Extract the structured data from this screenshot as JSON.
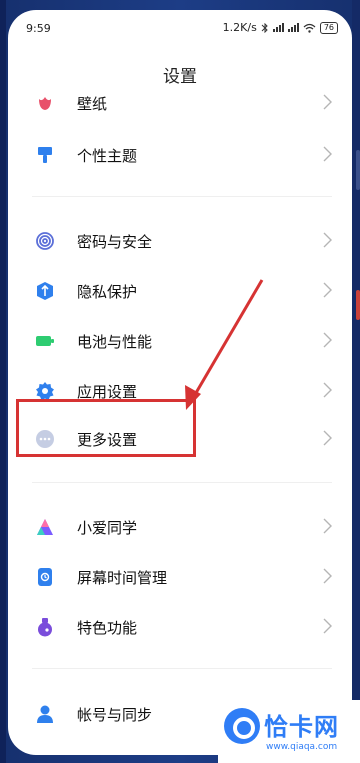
{
  "status_bar": {
    "time": "9:59",
    "net_speed": "1.2K/s",
    "battery": "76"
  },
  "header": {
    "title": "设置"
  },
  "groups": [
    {
      "items": [
        {
          "label": "壁纸",
          "icon": "flower-icon",
          "color": "#e8506a"
        },
        {
          "label": "个性主题",
          "icon": "paint-brush-icon",
          "color": "#2f80ed"
        }
      ]
    },
    {
      "items": [
        {
          "label": "密码与安全",
          "icon": "fingerprint-icon",
          "color": "#5b6fd8"
        },
        {
          "label": "隐私保护",
          "icon": "privacy-shield-icon",
          "color": "#2f80ed"
        },
        {
          "label": "电池与性能",
          "icon": "battery-icon",
          "color": "#2ecc71"
        },
        {
          "label": "应用设置",
          "icon": "gear-icon",
          "color": "#2f80ed"
        },
        {
          "label": "更多设置",
          "icon": "more-dots-icon",
          "color": "#9aa6c7"
        }
      ]
    },
    {
      "items": [
        {
          "label": "小爱同学",
          "icon": "xiaoai-icon",
          "color": "#7a5cff"
        },
        {
          "label": "屏幕时间管理",
          "icon": "screen-time-icon",
          "color": "#2f80ed"
        },
        {
          "label": "特色功能",
          "icon": "flask-icon",
          "color": "#7a4ddb"
        }
      ]
    },
    {
      "items": [
        {
          "label": "帐号与同步",
          "icon": "account-icon",
          "color": "#2f80ed"
        }
      ]
    }
  ],
  "watermark": {
    "brand": "恰卡网",
    "url": "www.qiaqa.com"
  },
  "annotation": {
    "color": "#d63333"
  }
}
